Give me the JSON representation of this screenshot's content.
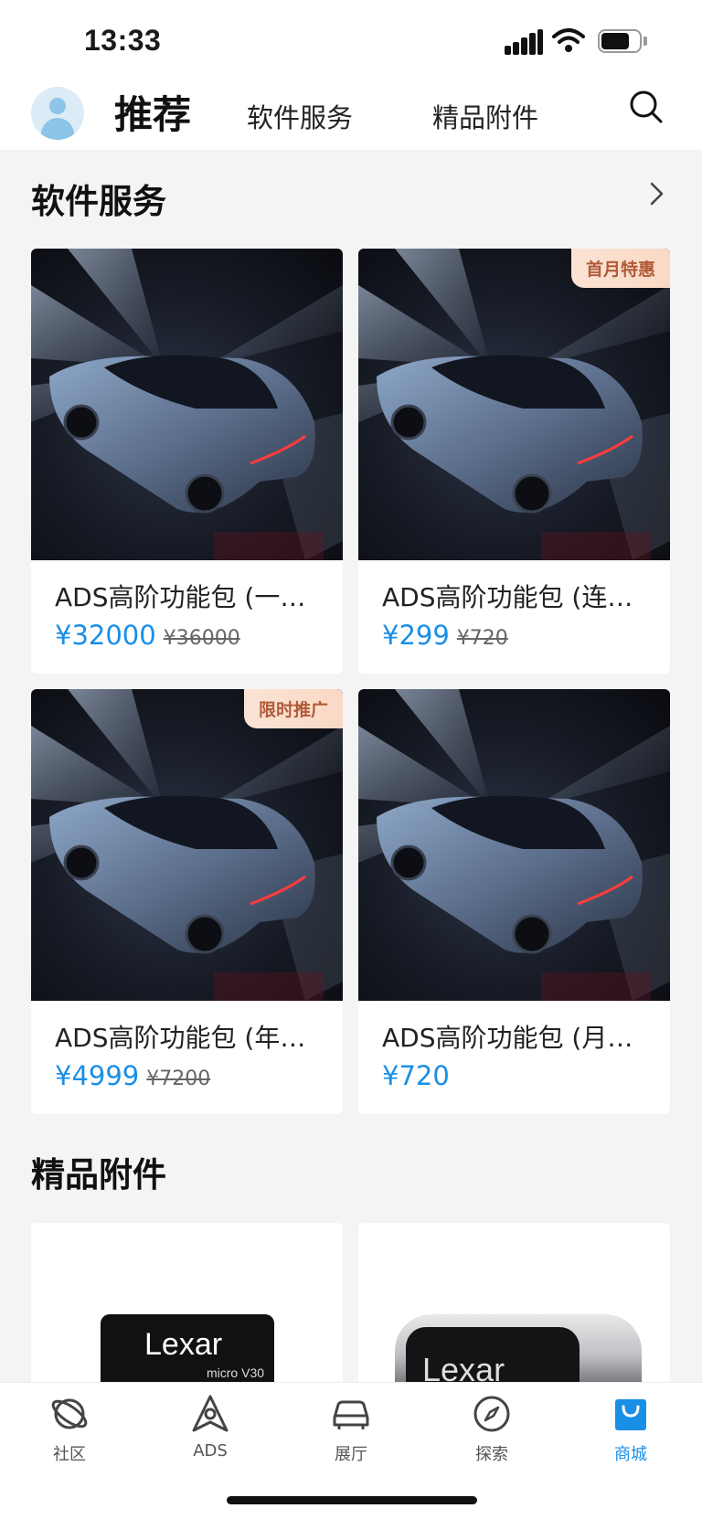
{
  "status_bar": {
    "time": "13:33"
  },
  "header": {
    "active_tab": "推荐",
    "tabs": [
      "软件服务",
      "精品附件"
    ]
  },
  "software_section": {
    "title": "软件服务",
    "products": [
      {
        "name": "ADS高阶功能包 (一…",
        "price": "¥32000",
        "old_price": "¥36000",
        "badge": ""
      },
      {
        "name": "ADS高阶功能包 (连…",
        "price": "¥299",
        "old_price": "¥720",
        "badge": "首月特惠"
      },
      {
        "name": "ADS高阶功能包 (年…",
        "price": "¥4999",
        "old_price": "¥7200",
        "badge": "限时推广"
      },
      {
        "name": "ADS高阶功能包 (月…",
        "price": "¥720",
        "old_price": "",
        "badge": ""
      }
    ]
  },
  "accessories_section": {
    "title": "精品附件",
    "items": [
      {
        "brand": "Lexar",
        "sub": "micro V30"
      },
      {
        "brand": "Lexar"
      }
    ]
  },
  "bottom_nav": {
    "items": [
      {
        "label": "社区",
        "icon": "planet-icon",
        "active": false
      },
      {
        "label": "ADS",
        "icon": "ads-icon",
        "active": false
      },
      {
        "label": "展厅",
        "icon": "car-icon",
        "active": false
      },
      {
        "label": "探索",
        "icon": "compass-icon",
        "active": false
      },
      {
        "label": "商城",
        "icon": "shopping-bag-icon",
        "active": true
      }
    ]
  },
  "colors": {
    "accent": "#1a8fe6",
    "badge_text": "#b15a3a"
  }
}
